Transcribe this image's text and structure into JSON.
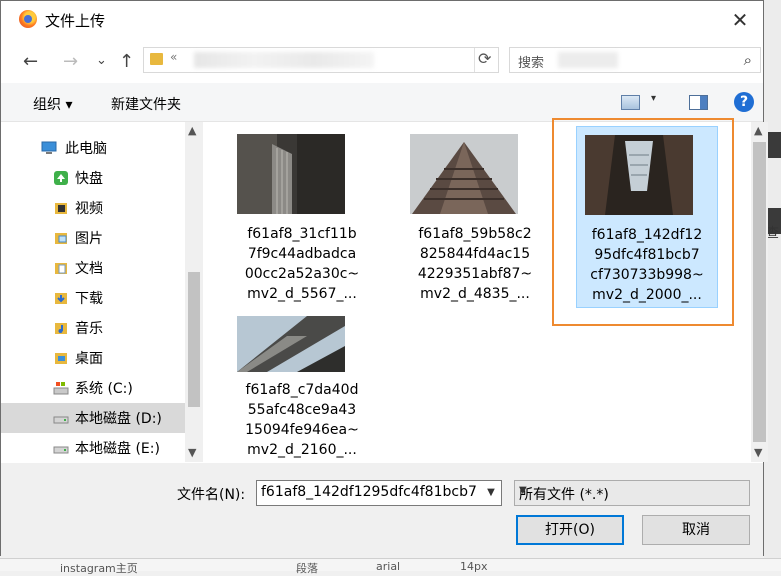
{
  "window": {
    "title": "文件上传",
    "close": "✕"
  },
  "nav_buttons": {
    "back": "←",
    "forward": "→",
    "recent": "⌄",
    "up": "↑"
  },
  "address": {
    "chevron": "«",
    "refresh": "⟳"
  },
  "search": {
    "placeholder": "搜索",
    "icon": "⌕"
  },
  "toolbar": {
    "organize": "组织 ▾",
    "new_folder": "新建文件夹",
    "help": "?",
    "view_dropdown": "▾"
  },
  "sidebar": {
    "items": [
      {
        "label": "此电脑",
        "icon": "pc-icon"
      },
      {
        "label": "快盘",
        "icon": "kuaipan-icon"
      },
      {
        "label": "视频",
        "icon": "video-folder-icon"
      },
      {
        "label": "图片",
        "icon": "pictures-folder-icon"
      },
      {
        "label": "文档",
        "icon": "documents-folder-icon"
      },
      {
        "label": "下载",
        "icon": "downloads-folder-icon"
      },
      {
        "label": "音乐",
        "icon": "music-folder-icon"
      },
      {
        "label": "桌面",
        "icon": "desktop-folder-icon"
      },
      {
        "label": "系统 (C:)",
        "icon": "system-drive-icon"
      },
      {
        "label": "本地磁盘 (D:)",
        "icon": "drive-icon",
        "selected": true
      },
      {
        "label": "本地磁盘 (E:)",
        "icon": "drive-icon"
      }
    ]
  },
  "files": [
    {
      "lines": [
        "f61af8_31cf11b",
        "7f9c44adbadca",
        "00cc2a52a30c~",
        "mv2_d_5567_..."
      ]
    },
    {
      "lines": [
        "f61af8_59b58c2",
        "825844fd4ac15",
        "4229351abf87~",
        "mv2_d_4835_..."
      ]
    },
    {
      "lines": [
        "f61af8_142df12",
        "95dfc4f81bcb7",
        "cf730733b998~",
        "mv2_d_2000_..."
      ],
      "selected": true
    },
    {
      "lines": [
        "f61af8_c7da40d",
        "55afc48ce9a43",
        "15094fe946ea~",
        "mv2_d_2160_..."
      ]
    }
  ],
  "footer": {
    "filename_label": "文件名(N):",
    "filename_value": "f61af8_142df1295dfc4f81bcb7",
    "filetype_value": "所有文件 (*.*)",
    "open_button": "打开(O)",
    "cancel_button": "取消"
  },
  "background": {
    "side_text": "查",
    "taskbar_items": [
      "instagram主页",
      "段落",
      "arial",
      "14px"
    ]
  },
  "colors": {
    "accent": "#0078d7",
    "highlight_box": "#ee8a30",
    "selection": "#cce8ff"
  }
}
